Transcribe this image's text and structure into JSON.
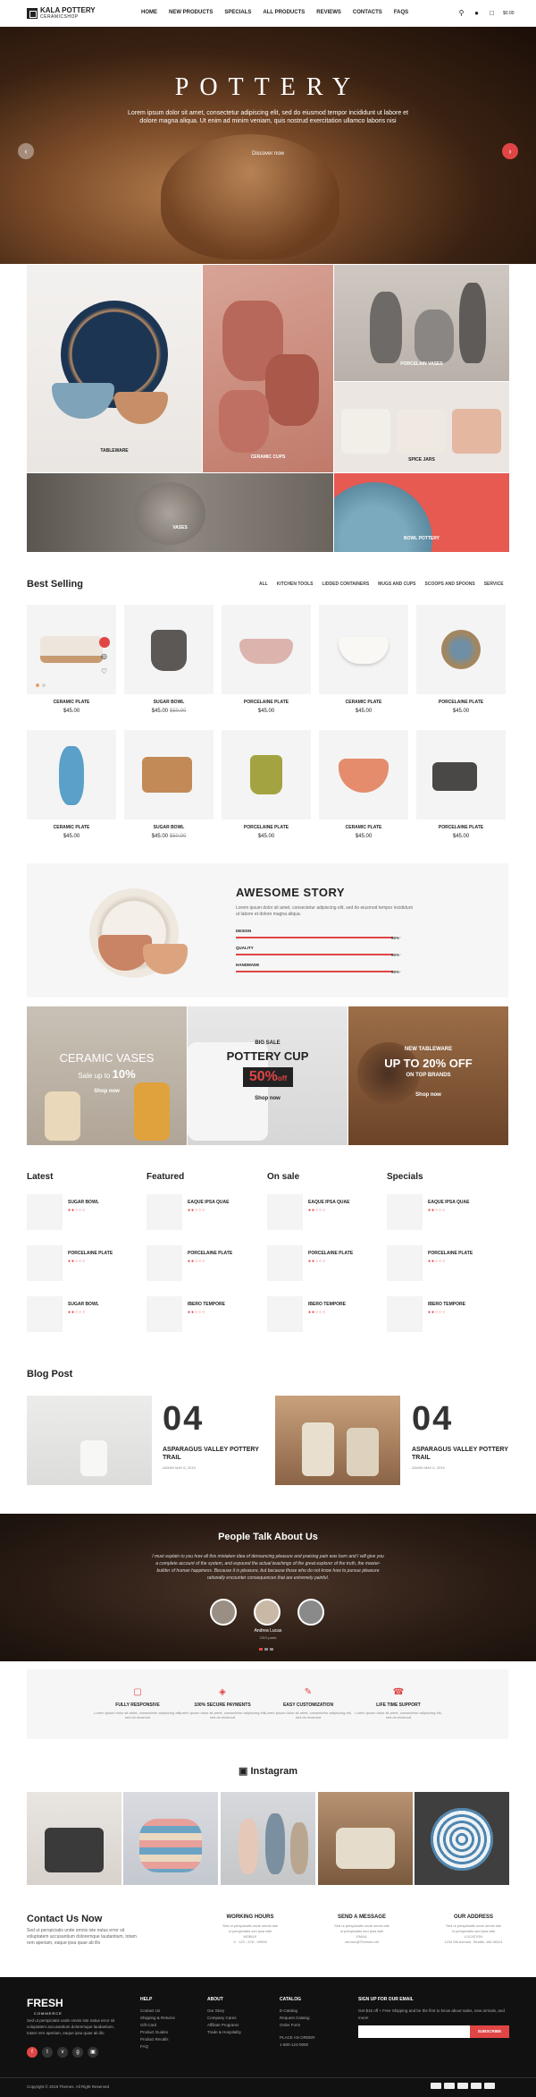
{
  "header": {
    "logo_title": "KALA POTTERY",
    "logo_sub": "CERAMICSHOP",
    "nav": [
      "HOME",
      "NEW PRODUCTS",
      "SPECIALS",
      "ALL PRODUCTS",
      "REVIEWS",
      "CONTACTS",
      "FAQS"
    ],
    "cart_total": "$0.00"
  },
  "hero": {
    "title": "POTTERY",
    "text": "Lorem ipsum dolor sit amet, consectetur adipiscing elit, sed do eiusmod tempor incididunt ut labore et dolore magna aliqua. Ut enim ad minim veniam, quis nostrud exercitation ullamco laboris nisi",
    "button": "Discover now"
  },
  "categories": [
    "TABLEWARE",
    "CERAMIC CUPS",
    "PORCELAIN VASES",
    "SPICE JARS",
    "BOWL POTTERY",
    "VASES"
  ],
  "best_selling": {
    "title": "Best Selling",
    "tabs": [
      "ALL",
      "KITCHEN TOOLS",
      "LIDDED CONTAINERS",
      "MUGS AND CUPS",
      "SCOOPS AND SPOONS",
      "SERVICE"
    ],
    "products": [
      {
        "name": "CERAMIC PLATE",
        "price": "$45.00",
        "old": ""
      },
      {
        "name": "SUGAR BOWL",
        "price": "$45.00",
        "old": "$50.00"
      },
      {
        "name": "PORCELAINE PLATE",
        "price": "$45.00",
        "old": ""
      },
      {
        "name": "CERAMIC PLATE",
        "price": "$45.00",
        "old": ""
      },
      {
        "name": "PORCELAINE PLATE",
        "price": "$45.00",
        "old": ""
      },
      {
        "name": "CERAMIC PLATE",
        "price": "$45.00",
        "old": ""
      },
      {
        "name": "SUGAR BOWL",
        "price": "$45.00",
        "old": "$50.00"
      },
      {
        "name": "PORCELAINE PLATE",
        "price": "$45.00",
        "old": ""
      },
      {
        "name": "CERAMIC PLATE",
        "price": "$45.00",
        "old": ""
      },
      {
        "name": "PORCELAINE PLATE",
        "price": "$45.00",
        "old": ""
      }
    ]
  },
  "story": {
    "title": "AWESOME STORY",
    "text": "Lorem ipsum dolor sit amet, consectetur adipiscing elit, sed do eiusmod tempor incididunt ut labore et dolore magna aliqua.",
    "bars": [
      {
        "label": "DESIGN",
        "pct": "95%",
        "value": 0.95
      },
      {
        "label": "QUALITY",
        "pct": "95%",
        "value": 0.95
      },
      {
        "label": "HANDMADE",
        "pct": "95%",
        "value": 0.95
      }
    ]
  },
  "banners": [
    {
      "title": "CERAMIC VASES",
      "sub": "Sale up to",
      "pct": "10%",
      "btn": "Shop now"
    },
    {
      "tag": "BIG SALE",
      "title": "POTTERY CUP",
      "pct": "50%",
      "off": "off",
      "btn": "Shop now"
    },
    {
      "tag": "NEW TABLEWARE",
      "title": "UP TO 20% OFF",
      "sub": "ON TOP BRANDS",
      "btn": "Shop now"
    }
  ],
  "lists": [
    {
      "title": "Latest",
      "items": [
        "SUGAR BOWL",
        "PORCELAINE PLATE",
        "SUGAR BOWL"
      ]
    },
    {
      "title": "Featured",
      "items": [
        "EAQUE IPSA QUAE",
        "PORCELAINE PLATE",
        "IBERO TEMPORE"
      ]
    },
    {
      "title": "On sale",
      "items": [
        "EAQUE IPSA QUAE",
        "PORCELAINE PLATE",
        "IBERO TEMPORE"
      ]
    },
    {
      "title": "Specials",
      "items": [
        "EAQUE IPSA QUAE",
        "PORCELAINE PLATE",
        "IBERO TEMPORE"
      ]
    }
  ],
  "blog": {
    "title": "Blog Post",
    "posts": [
      {
        "num": "04",
        "title": "ASPARAGUS VALLEY POTTERY TRAIL",
        "meta": "ADMIN MAY 6, 2019"
      },
      {
        "num": "04",
        "title": "ASPARAGUS VALLEY POTTERY TRAIL",
        "meta": "ADMIN MAY 6, 2019"
      }
    ]
  },
  "testimonials": {
    "title": "People Talk About Us",
    "text": "I must explain to you how all this mistaken idea of denouncing pleasure and praising pain was born and I will give you a complete account of the system, and expound the actual teachings of the great explorer of the truth, the master-builder of human happiness. Because it is pleasure, but because those who do not know how to pursue pleasure rationally encounter consequences that are extremely painful.",
    "name": "Andrea Lucas",
    "role": "CEO parts"
  },
  "features": [
    {
      "name": "FULLY RESPONSIVE",
      "desc": "Lorem ipsum dolor sit amet, consectetur adipiscing elit, sed do eiusmod"
    },
    {
      "name": "100% SECURE PAYMENTS",
      "desc": "Lorem ipsum dolor sit amet, consectetur adipiscing elit, sed do eiusmod"
    },
    {
      "name": "EASY CUSTOMIZATION",
      "desc": "Lorem ipsum dolor sit amet, consectetur adipiscing elit, sed do eiusmod"
    },
    {
      "name": "LIFE TIME SUPPORT",
      "desc": "Lorem ipsum dolor sit amet, consectetur adipiscing elit, sed do eiusmod"
    }
  ],
  "instagram": {
    "title": "Instagram"
  },
  "contact": {
    "title": "Contact Us Now",
    "text": "Sed ut perspiciatis unde omnis iste natus error sit voluptatem accusantium doloremque laudantium, totam rem aperiam, eaque ipsa quae ab illo",
    "cols": [
      {
        "head": "WORKING HOURS",
        "lines": [
          "Sed ut perspiciatis unde omnis iste",
          "ut perspiciatis sed ipsa with",
          "MOBILE",
          "0 - 123 - 678 - 99999"
        ]
      },
      {
        "head": "SEND A MESSAGE",
        "lines": [
          "Sed ut perspiciatis unde omnis iste",
          "ut perspiciatis sed ipsa with",
          "EMAIL",
          "service@Themes.net"
        ]
      },
      {
        "head": "OUR ADDRESS",
        "lines": [
          "Sed ut perspiciatis unde omnis iste",
          "ut perspiciatis sed ipsa with",
          "LOCATION",
          "1234 5th Avenue, Seattle, WA 98101"
        ]
      }
    ]
  },
  "footer": {
    "brand": "FRESH",
    "brand_sub": "COMMERCE",
    "about": "Sed ut perspiciatis unde omnis iste natus error sit voluptatem accusantium doloremque laudantium, totam rem aperiam, eaque ipsa quae ab illo",
    "cols": [
      {
        "head": "HELP",
        "items": [
          "Contact Us",
          "Shipping & Returns",
          "Gift Card",
          "Product Guides",
          "Product Recalls",
          "FAQ"
        ]
      },
      {
        "head": "ABOUT",
        "items": [
          "Our Story",
          "Company Cares",
          "Affiliate Programs",
          "Trade & Hospitality"
        ]
      },
      {
        "head": "CATALOG",
        "items": [
          "E-Catalog",
          "Request Catalog",
          "Order Form",
          "",
          "PLACE AN ORDER",
          "1-800-123-0000"
        ]
      }
    ],
    "newsletter_head": "SIGN UP FOR OUR EMAIL",
    "newsletter_text": "Get $15 off + Free Shipping and be the first to know about sales, new arrivals, and more!",
    "newsletter_btn": "SUBSCRIBE",
    "copyright": "Copyright © 2019 Themes. All Right Reserved"
  },
  "colors": {
    "accent": "#e04545",
    "dark": "#111111"
  }
}
